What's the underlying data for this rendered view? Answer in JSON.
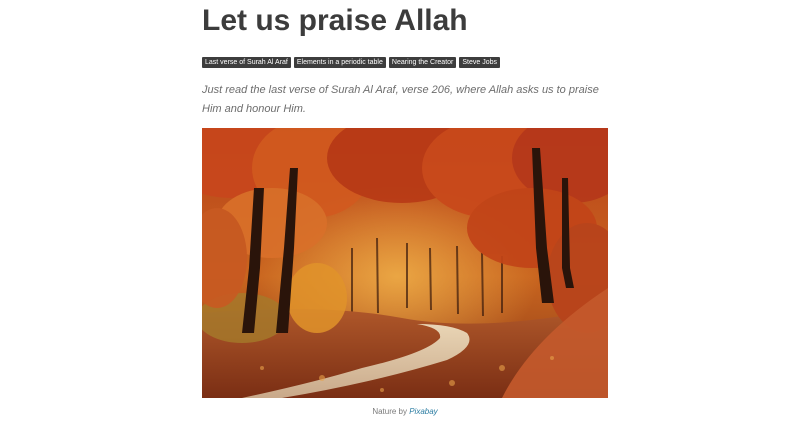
{
  "article": {
    "title": "Let us praise Allah",
    "tags": [
      "Last verse of Surah Al Araf",
      "Elements in a periodic table",
      "Nearing the Creator",
      "Steve Jobs"
    ],
    "intro": "Just read the last verse of Surah Al Araf, verse 206, where Allah asks us to praise Him and honour Him.",
    "image": {
      "subject": "autumn-forest-path"
    },
    "caption": {
      "prefix": "Nature by ",
      "link_label": "Pixabay"
    }
  },
  "colors": {
    "text": "#3c3c3c",
    "tag_bg": "#3d3d3d",
    "intro_text": "#6d6d6d",
    "link": "#2d7ea3"
  }
}
